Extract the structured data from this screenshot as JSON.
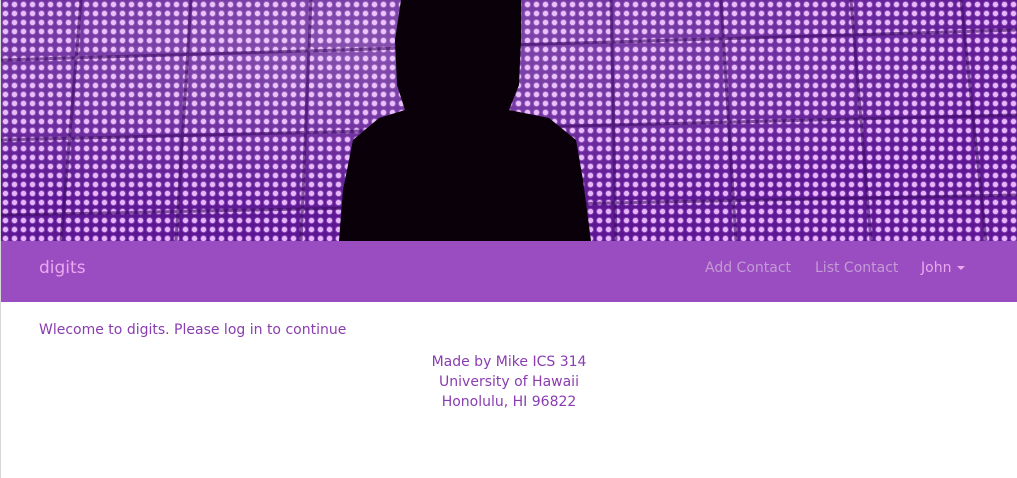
{
  "hero": {
    "image": "purple-led-wall-silhouette"
  },
  "navbar": {
    "brand": "digits",
    "links": [
      {
        "label": "Add Contact"
      },
      {
        "label": "List Contact"
      }
    ],
    "user_menu": {
      "label": "John",
      "icon": "caret-down-icon"
    }
  },
  "main": {
    "welcome": "Wlecome to digits. Please log in to continue"
  },
  "footer": {
    "line1": "Made by Mike ICS 314",
    "line2": "University of Hawaii",
    "line3": "Honolulu, HI 96822"
  },
  "colors": {
    "navbar_bg": "#9a4dc0",
    "brand": "#e9a8f0",
    "nav_link": "#c49ad6",
    "text": "#8a3db0"
  }
}
